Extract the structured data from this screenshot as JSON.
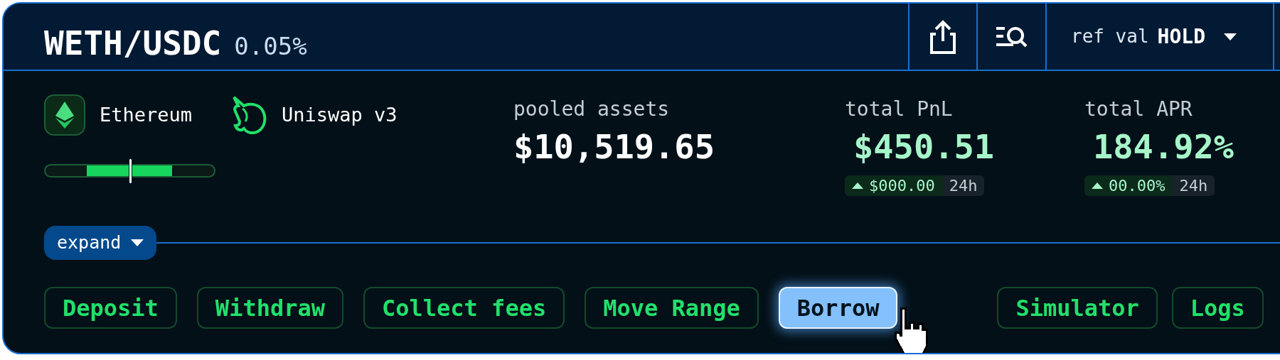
{
  "header": {
    "pair": "WETH/USDC",
    "fee_tier": "0.05%",
    "ref_value": {
      "label": "ref val",
      "value": "HOLD"
    }
  },
  "chain": {
    "name": "Ethereum"
  },
  "protocol": {
    "name": "Uniswap v3"
  },
  "range": {
    "level": 0.5
  },
  "stats": [
    {
      "kind": "plain",
      "label": "pooled assets",
      "value": "$10,519.65"
    },
    {
      "kind": "gain",
      "label": "total PnL",
      "value": "$450.51",
      "change": "$000.00",
      "period": "24h"
    },
    {
      "kind": "gain",
      "label": "total APR",
      "value": "184.92%",
      "change": "00.00%",
      "period": "24h"
    }
  ],
  "expand": {
    "label": "expand",
    "expanded": false
  },
  "actions": [
    {
      "label": "Deposit",
      "selected": false
    },
    {
      "label": "Withdraw",
      "selected": false
    },
    {
      "label": "Collect fees",
      "selected": false
    },
    {
      "label": "Move Range",
      "selected": false
    },
    {
      "label": "Borrow",
      "selected": true
    }
  ],
  "tools": [
    {
      "label": "Simulator",
      "selected": false
    },
    {
      "label": "Logs",
      "selected": false
    }
  ]
}
